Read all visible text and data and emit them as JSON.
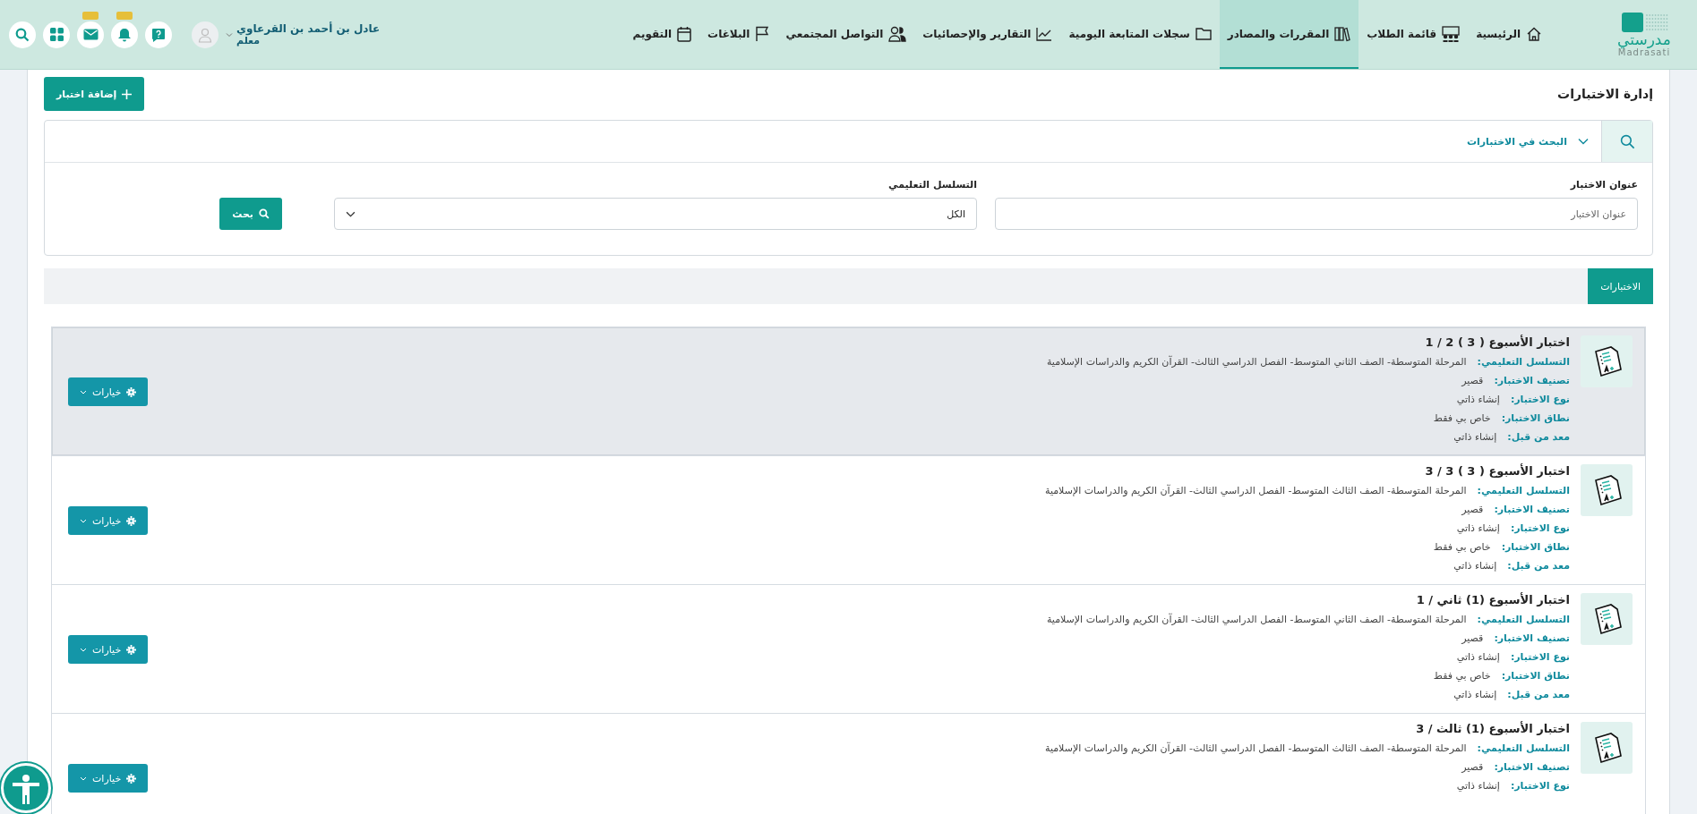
{
  "header": {
    "logo": {
      "name": "مدرستي",
      "latin": "Madrasati"
    },
    "nav": [
      {
        "label": "الرئيسية",
        "kind": "home",
        "selected": false
      },
      {
        "label": "قائمة الطلاب",
        "kind": "students",
        "selected": false
      },
      {
        "label": "المقررات والمصادر",
        "kind": "books",
        "selected": true
      },
      {
        "label": "سجلات المتابعة اليومية",
        "kind": "folder",
        "selected": false
      },
      {
        "label": "التقارير والإحصائيات",
        "kind": "chart",
        "selected": false
      },
      {
        "label": "التواصل المجتمعي",
        "kind": "people",
        "selected": false
      },
      {
        "label": "البلاغات",
        "kind": "flag",
        "selected": false
      },
      {
        "label": "التقويم",
        "kind": "calendar",
        "selected": false
      }
    ],
    "user": {
      "name": "عادل بن أحمد بن القرعاوي",
      "role": "معلم"
    },
    "actions": [
      {
        "kind": "help",
        "badge": false
      },
      {
        "kind": "bell",
        "badge": true
      },
      {
        "kind": "mail",
        "badge": true
      },
      {
        "kind": "apps",
        "badge": false
      },
      {
        "kind": "search",
        "badge": false
      }
    ]
  },
  "page": {
    "title": "إدارة الاختبارات",
    "add_button": "إضافة اختبار"
  },
  "search_panel": {
    "title": "البحث في الاختبارات",
    "expanded": true,
    "fields": [
      {
        "kind": "text",
        "label": "عنوان الاختبار",
        "placeholder": "عنوان الاختبار"
      },
      {
        "kind": "select",
        "label": "التسلسل التعليمي",
        "value": "الكل"
      }
    ],
    "button": "بحث"
  },
  "tabs": [
    {
      "label": "الاختبارات",
      "selected": true
    }
  ],
  "tests": [
    {
      "title": "اختبار الأسبوع ( 3 ) 2 / 1",
      "highlighted": true,
      "options_button": "خيارات",
      "fields": [
        {
          "label": "التسلسل التعليمي:",
          "value": "المرحلة المتوسطة- الصف الثاني المتوسط- الفصل الدراسي الثالث- القرآن الكريم والدراسات الإسلامية"
        },
        {
          "label": "تصنيف الاختبار:",
          "value": "قصير"
        },
        {
          "label": "نوع الاختبار:",
          "value": "إنشاء ذاتي"
        },
        {
          "label": "نطاق الاختبار:",
          "value": "خاص بي فقط"
        },
        {
          "label": "معد من قبل:",
          "value": "إنشاء ذاتي"
        }
      ]
    },
    {
      "title": "اختبار الأسبوع ( 3 ) 3 / 3",
      "highlighted": false,
      "options_button": "خيارات",
      "fields": [
        {
          "label": "التسلسل التعليمي:",
          "value": "المرحلة المتوسطة- الصف الثالث المتوسط- الفصل الدراسي الثالث- القرآن الكريم والدراسات الإسلامية"
        },
        {
          "label": "تصنيف الاختبار:",
          "value": "قصير"
        },
        {
          "label": "نوع الاختبار:",
          "value": "إنشاء ذاتي"
        },
        {
          "label": "نطاق الاختبار:",
          "value": "خاص بي فقط"
        },
        {
          "label": "معد من قبل:",
          "value": "إنشاء ذاتي"
        }
      ]
    },
    {
      "title": "اختبار الأسبوع (1) ثاني / 1",
      "highlighted": false,
      "options_button": "خيارات",
      "fields": [
        {
          "label": "التسلسل التعليمي:",
          "value": "المرحلة المتوسطة- الصف الثاني المتوسط- الفصل الدراسي الثالث- القرآن الكريم والدراسات الإسلامية"
        },
        {
          "label": "تصنيف الاختبار:",
          "value": "قصير"
        },
        {
          "label": "نوع الاختبار:",
          "value": "إنشاء ذاتي"
        },
        {
          "label": "نطاق الاختبار:",
          "value": "خاص بي فقط"
        },
        {
          "label": "معد من قبل:",
          "value": "إنشاء ذاتي"
        }
      ]
    },
    {
      "title": "اختبار الأسبوع (1) ثالث / 3",
      "highlighted": false,
      "options_button": "خيارات",
      "fields": [
        {
          "label": "التسلسل التعليمي:",
          "value": "المرحلة المتوسطة- الصف الثالث المتوسط- الفصل الدراسي الثالث- القرآن الكريم والدراسات الإسلامية"
        },
        {
          "label": "تصنيف الاختبار:",
          "value": "قصير"
        },
        {
          "label": "نوع الاختبار:",
          "value": "إنشاء ذاتي"
        }
      ]
    }
  ]
}
